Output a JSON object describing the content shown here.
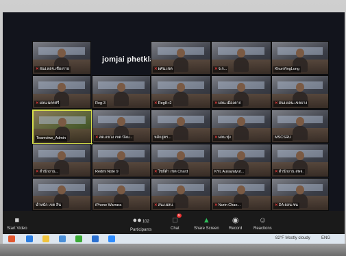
{
  "active_speaker": "jomjai phetkla",
  "tiles": [
    {
      "name": "สนง.ผลจ.เชียงราย",
      "muted": true
    },
    {
      "name": "",
      "muted": false
    },
    {
      "name": "ผศน.เขต",
      "muted": true
    },
    {
      "name": "จ.ก...",
      "muted": true
    },
    {
      "name": "KhunYingLong",
      "muted": false
    },
    {
      "name": "ผลน.นครศรี",
      "muted": true
    },
    {
      "name": "Reg-3",
      "muted": false
    },
    {
      "name": "Reg8-r2",
      "muted": true
    },
    {
      "name": "ผลน.เมืองตาก",
      "muted": true
    },
    {
      "name": "สนง.ผลน.เขตบาง",
      "muted": true
    },
    {
      "name": "Teamviwe_Admin",
      "muted": false
    },
    {
      "name": "สต.แขวง เขต ป้อม...",
      "muted": true
    },
    {
      "name": "หลักสูตร...",
      "muted": false
    },
    {
      "name": "ผลน.ทุ่ง",
      "muted": true
    },
    {
      "name": "MSCSRU",
      "muted": false
    },
    {
      "name": "สำนักงาน...",
      "muted": true
    },
    {
      "name": "Redmi Note 9",
      "muted": false
    },
    {
      "name": "ไชย์ต่ำ เขต Chard",
      "muted": true
    },
    {
      "name": "KYL Ausayatyut...",
      "muted": false
    },
    {
      "name": "สำนักงาน สพจ.",
      "muted": true
    },
    {
      "name": "น้ำหนัก เขต สิน",
      "muted": false
    },
    {
      "name": "iPhone Warrara",
      "muted": false
    },
    {
      "name": "สนง.ผลบ.",
      "muted": true
    },
    {
      "name": "Nurin Chao...",
      "muted": true
    },
    {
      "name": "DA ผลน.ชน",
      "muted": true
    }
  ],
  "toolbar": {
    "start_video": "Start Video",
    "participants": "Participants",
    "participants_count": "102",
    "chat": "Chat",
    "chat_badge": "5",
    "share_screen": "Share Screen",
    "record": "Record",
    "reactions": "Reactions"
  },
  "taskbar": {
    "weather": "82°F  Mostly cloudy",
    "tray": "ENG"
  }
}
